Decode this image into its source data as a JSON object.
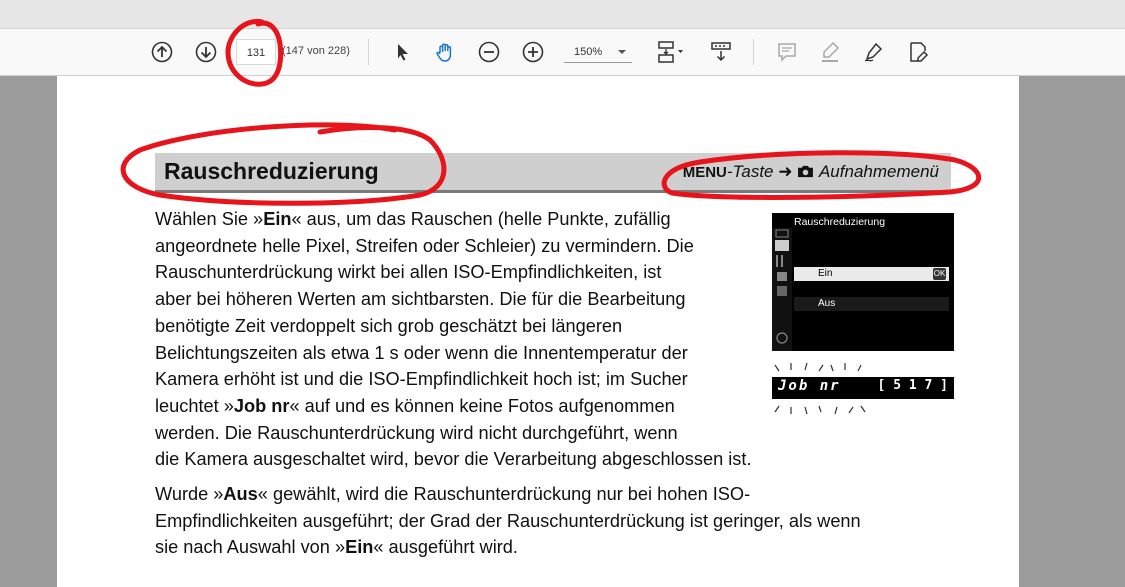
{
  "toolbar": {
    "page_current": "131",
    "page_of": "(147 von 228)",
    "zoom": "150%",
    "tools": [
      "previous-page",
      "next-page",
      "select-tool",
      "hand-tool",
      "zoom-out",
      "zoom-in",
      "fit-page",
      "scroll-mode",
      "comment",
      "highlight",
      "sign",
      "edit"
    ]
  },
  "document": {
    "heading": "Rauschreduzierung",
    "nav": {
      "menu": "MENU",
      "taste": "-Taste",
      "arrow": "➜",
      "menu_name": "Aufnahmemenü"
    },
    "paragraph1_lines": [
      [
        "Wählen Sie »",
        {
          "b": "Ein"
        },
        "« aus, um das Rauschen (helle Punkte, zufällig"
      ],
      [
        "angeordnete helle Pixel, Streifen oder Schleier) zu vermindern.  Die"
      ],
      [
        "Rauschunterdrückung wirkt bei allen ISO-Empfindlichkeiten, ist"
      ],
      [
        "aber bei höheren Werten am sichtbarsten.  Die für die Bearbeitung"
      ],
      [
        "benötigte Zeit verdoppelt sich grob geschätzt bei längeren"
      ],
      [
        "Belichtungszeiten als etwa 1 s oder wenn die Innentemperatur der"
      ],
      [
        "Kamera erhöht ist und die ISO-Empfindlichkeit hoch ist; im Sucher"
      ],
      [
        "leuchtet »",
        {
          "b": "Job nr"
        },
        "« auf und es können keine Fotos aufgenommen"
      ],
      [
        "werden.  Die Rauschunterdrückung wird nicht durchgeführt, wenn"
      ],
      [
        "die Kamera ausgeschaltet wird, bevor die Verarbeitung abgeschlossen ist."
      ]
    ],
    "paragraph2_lines": [
      [
        "Wurde »",
        {
          "b": "Aus"
        },
        "« gewählt, wird die Rauschunterdrückung nur bei hohen ISO-"
      ],
      [
        "Empfindlichkeiten ausgeführt; der Grad der Rauschunterdrückung ist geringer, als wenn"
      ],
      [
        "sie nach Auswahl von »",
        {
          "b": "Ein"
        },
        "« ausgeführt wird."
      ]
    ],
    "camera_screen": {
      "title": "Rauschreduzierung",
      "option_on": "Ein",
      "option_off": "Aus",
      "ok_badge": "OK"
    },
    "viewfinder": {
      "text": "Job nr",
      "count": "[ 5 1 7 ]"
    }
  },
  "colors": {
    "annotation": "#e8141c",
    "hand_tool": "#1b74d8"
  }
}
